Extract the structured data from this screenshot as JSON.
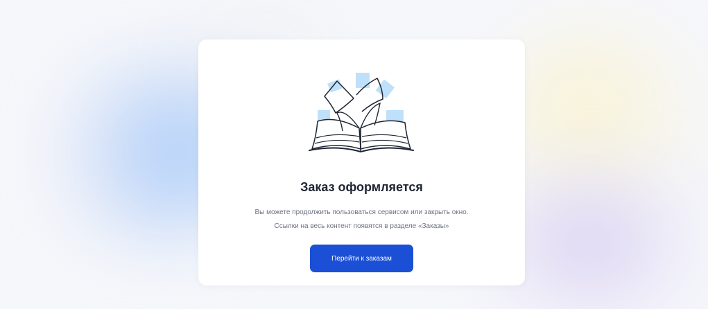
{
  "dialog": {
    "title": "Заказ оформляется",
    "description_line1": "Вы можете продолжить пользоваться сервисом или закрыть окно.",
    "description_line2": "Ссылки на весь контент появятся в разделе «Заказы»",
    "button_label": "Перейти к заказам"
  },
  "colors": {
    "accent": "#1b4fd6",
    "title": "#1f2533",
    "text": "#6d7282",
    "illustration_paper": "#bfe0fb",
    "illustration_line": "#1f2533"
  },
  "icons": {
    "illustration": "open-book-icon"
  }
}
